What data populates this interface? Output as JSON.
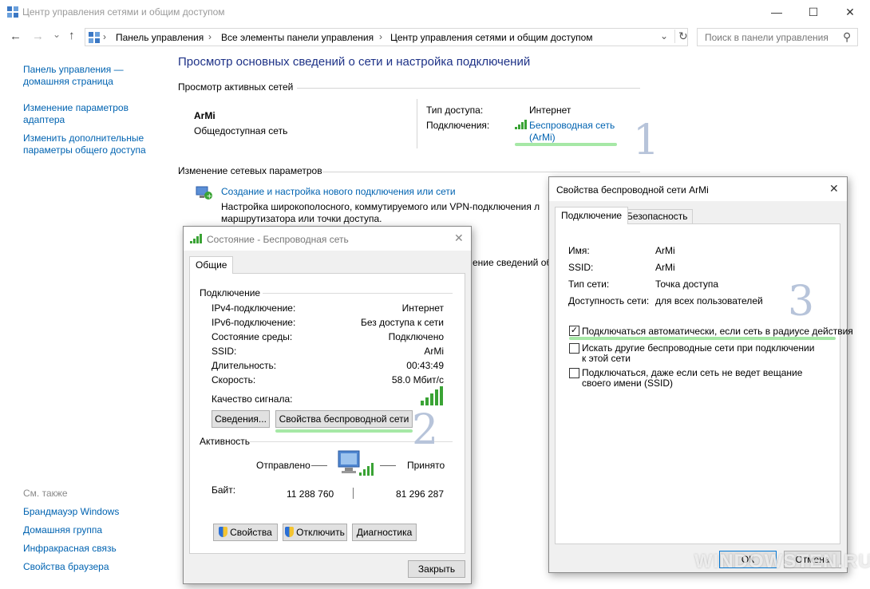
{
  "window": {
    "title": "Центр управления сетями и общим доступом",
    "minimize": "—",
    "maximize": "☐",
    "close": "✕"
  },
  "addressbar": {
    "back": "←",
    "forward": "→",
    "recent": "⌄",
    "up": "↑",
    "crumbs": [
      "Панель управления",
      "Все элементы панели управления",
      "Центр управления сетями и общим доступом"
    ],
    "sep": "›",
    "dropdown": "⌄",
    "refresh": "↻",
    "search_placeholder": "Поиск в панели управления",
    "search_icon": "⚲"
  },
  "sidebar": {
    "home": "Панель управления — домашняя страница",
    "adapter": "Изменение параметров адаптера",
    "sharing": "Изменить дополнительные параметры общего доступа",
    "see_also": "См. также",
    "links": [
      "Брандмауэр Windows",
      "Домашняя группа",
      "Инфракрасная связь",
      "Свойства браузера"
    ]
  },
  "main": {
    "heading": "Просмотр основных сведений о сети и настройка подключений",
    "active_title": "Просмотр активных сетей",
    "network_name": "ArMi",
    "network_type": "Общедоступная сеть",
    "access_label": "Тип доступа:",
    "access_value": "Интернет",
    "conn_label": "Подключения:",
    "conn_value": "Беспроводная сеть (ArMi)",
    "change_title": "Изменение сетевых параметров",
    "new_conn_link": "Создание и настройка нового подключения или сети",
    "new_conn_desc": "Настройка широкополосного, коммутируемого или VPN-подключения л маршрутизатора или точки доступа.",
    "hidden_tail": "ение сведений об"
  },
  "annotations": {
    "n1": "1",
    "n2": "2",
    "n3": "3"
  },
  "status": {
    "title": "Состояние - Беспроводная сеть",
    "close": "✕",
    "tab": "Общие",
    "connection_group": "Подключение",
    "rows": [
      {
        "label": "IPv4-подключение:",
        "value": "Интернет"
      },
      {
        "label": "IPv6-подключение:",
        "value": "Без доступа к сети"
      },
      {
        "label": "Состояние среды:",
        "value": "Подключено"
      },
      {
        "label": "SSID:",
        "value": "ArMi"
      },
      {
        "label": "Длительность:",
        "value": "00:43:49"
      },
      {
        "label": "Скорость:",
        "value": "58.0 Мбит/с"
      }
    ],
    "signal_label": "Качество сигнала:",
    "details_btn": "Сведения...",
    "wireless_props_btn": "Свойства беспроводной сети",
    "activity_group": "Активность",
    "sent_label": "Отправлено",
    "received_label": "Принято",
    "bytes_label": "Байт:",
    "bytes_sent": "11 288 760",
    "bytes_received": "81 296 287",
    "props_btn": "Свойства",
    "disable_btn": "Отключить",
    "diag_btn": "Диагностика",
    "close_btn": "Закрыть"
  },
  "wprops": {
    "title": "Свойства беспроводной сети ArMi",
    "close": "✕",
    "tabs": [
      "Подключение",
      "Безопасность"
    ],
    "rows": [
      {
        "label": "Имя:",
        "value": "ArMi"
      },
      {
        "label": "SSID:",
        "value": "ArMi"
      },
      {
        "label": "Тип сети:",
        "value": "Точка доступа"
      },
      {
        "label": "Доступность сети:",
        "value": "для всех пользователей"
      }
    ],
    "checkboxes": [
      {
        "label": "Подключаться автоматически, если сеть в радиусе действия",
        "checked": true
      },
      {
        "label": "Искать другие беспроводные сети при подключении к этой сети",
        "checked": false
      },
      {
        "label": "Подключаться, даже если сеть не ведет вещание своего имени (SSID)",
        "checked": false
      }
    ],
    "ok_btn": "ОК",
    "cancel_btn": "Отмена"
  },
  "watermark": "WINDOWSTEN.RU",
  "colors": {
    "link": "#0063b1",
    "highlight": "#a6e8a6",
    "annotation": "#b7c4da",
    "signal": "#3aa335"
  }
}
